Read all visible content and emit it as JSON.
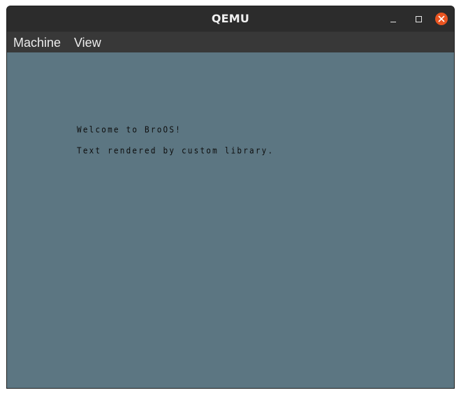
{
  "window": {
    "title": "QEMU"
  },
  "menubar": {
    "items": [
      {
        "label": "Machine"
      },
      {
        "label": "View"
      }
    ]
  },
  "vm_screen": {
    "lines": [
      "Welcome to BroOS!",
      "Text rendered by custom library."
    ],
    "background_color": "#5c7682",
    "text_color": "#0e0e0e"
  },
  "icons": {
    "minimize": "minimize-icon",
    "maximize": "maximize-icon",
    "close": "close-icon"
  },
  "colors": {
    "titlebar": "#2c2c2c",
    "menubar": "#383838",
    "close_accent": "#e95420"
  }
}
